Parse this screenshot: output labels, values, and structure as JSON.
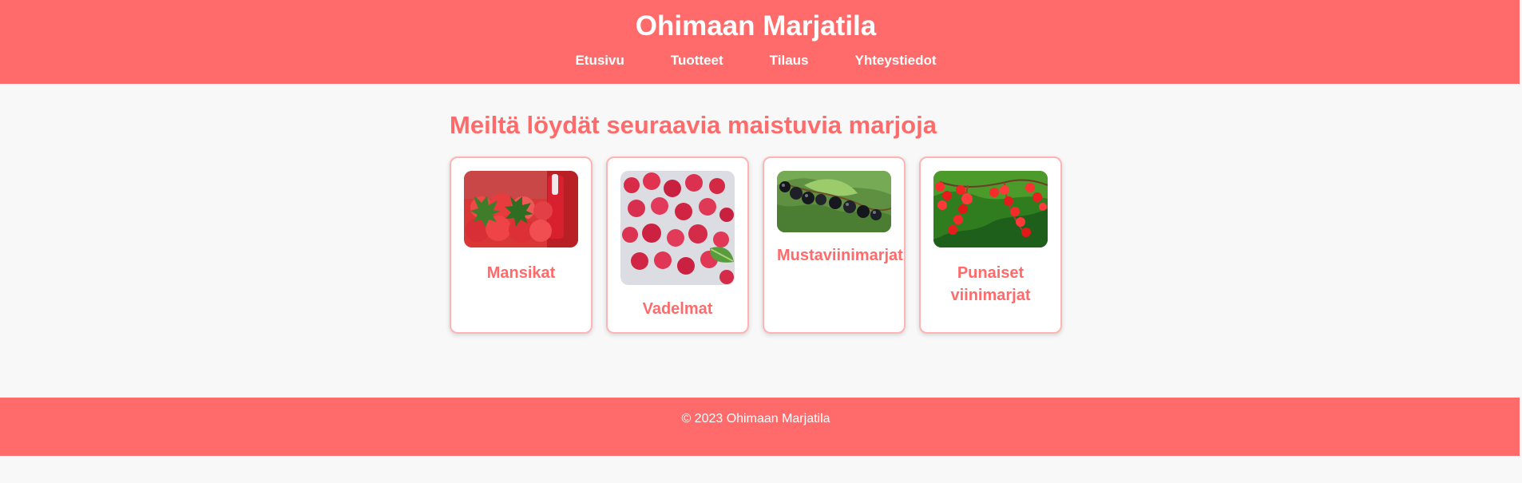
{
  "site": {
    "title": "Ohimaan Marjatila"
  },
  "nav": {
    "items": [
      {
        "label": "Etusivu"
      },
      {
        "label": "Tuotteet"
      },
      {
        "label": "Tilaus"
      },
      {
        "label": "Yhteystiedot"
      }
    ]
  },
  "main": {
    "title": "Meiltä löydät seuraavia maistuvia marjoja",
    "products": [
      {
        "name": "Mansikat",
        "image": "strawberries-image"
      },
      {
        "name": "Vadelmat",
        "image": "raspberries-image"
      },
      {
        "name": "Mustaviinimarjat",
        "image": "blackcurrants-image"
      },
      {
        "name": "Punaiset viinimarjat",
        "image": "redcurrants-image"
      }
    ]
  },
  "footer": {
    "copyright": "© 2023 Ohimaan Marjatila"
  },
  "colors": {
    "brand": "#ff6b6b",
    "page_background": "#f8f8f8",
    "card_border": "#ffb3b3",
    "text_light": "#ffffff"
  }
}
